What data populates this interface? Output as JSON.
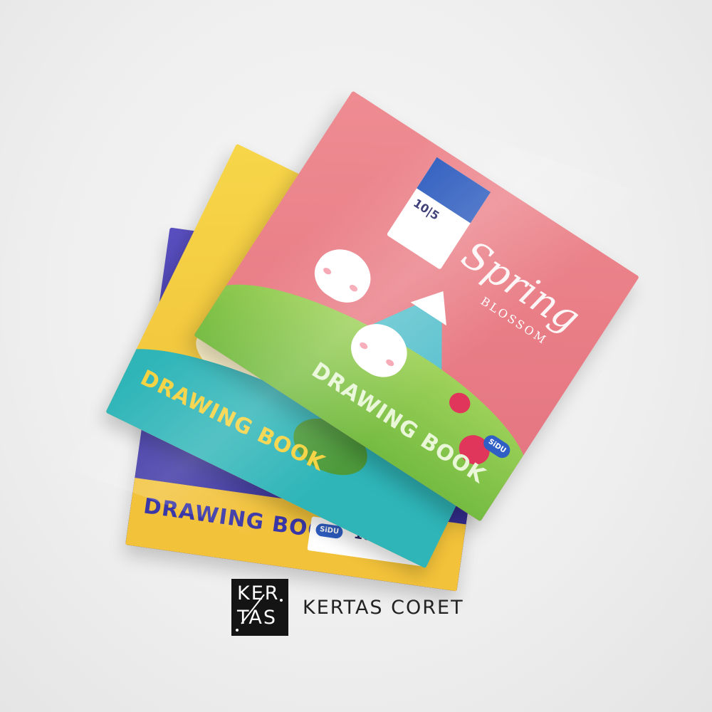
{
  "photo": {
    "books": [
      {
        "color": "#3c34a3",
        "band_color": "#f2c23a",
        "title": "DRAWING BOOK",
        "label": {
          "brand": "SiDU",
          "count": "10"
        }
      },
      {
        "color": "#f2c63c",
        "title": "DRAWING BOOK"
      },
      {
        "color": "#e97d86",
        "title": "DRAWING BOOK",
        "script_title": "Spring",
        "subtitle": "BLOSSOM",
        "label": {
          "count": "10|5"
        },
        "brand": "SiDU"
      }
    ]
  },
  "logo": {
    "line1": "KER",
    "line2": "TAS",
    "brand_name": "KERTAS CORET"
  }
}
